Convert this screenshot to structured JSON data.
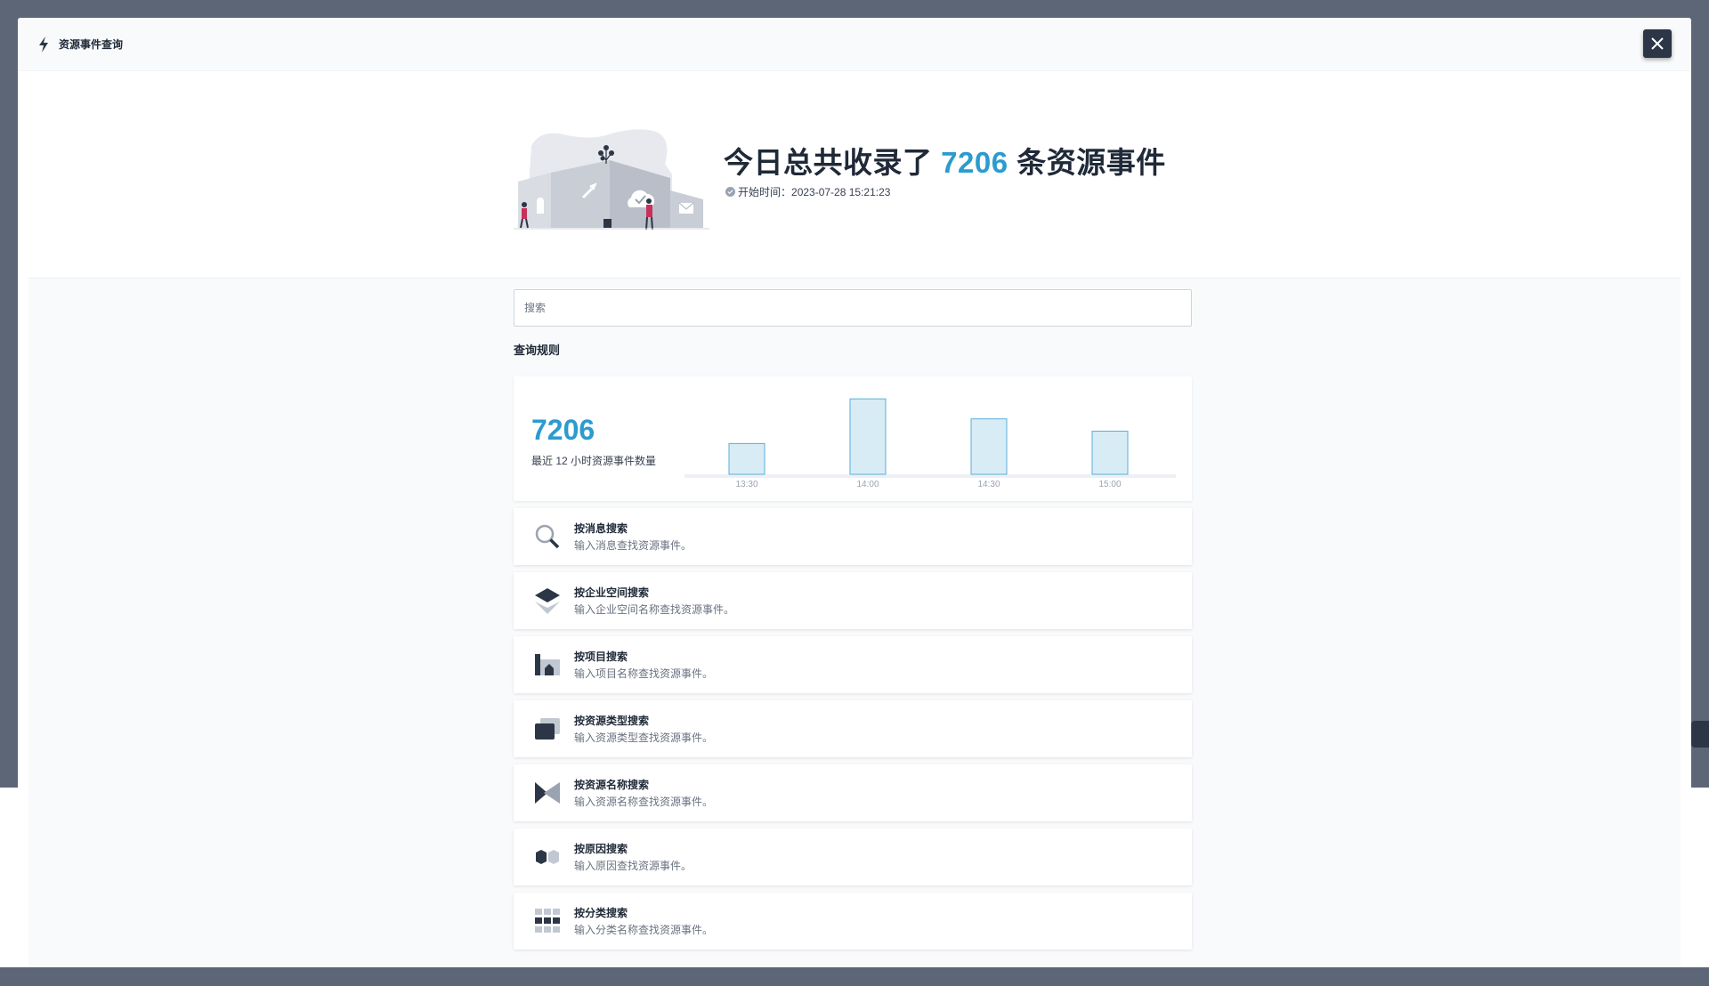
{
  "modal": {
    "title": "资源事件查询",
    "close_icon": "close-icon",
    "header_icon": "bolt-icon"
  },
  "hero": {
    "title_prefix": "今日总共收录了",
    "total": "7206",
    "title_suffix": "条资源事件",
    "start_label": "开始时间：",
    "start_time": "2023-07-28 15:21:23"
  },
  "search": {
    "placeholder": "搜索",
    "value": ""
  },
  "rules": {
    "section_title": "查询规则",
    "items": [
      {
        "title": "按消息搜索",
        "desc": "输入消息查找资源事件。",
        "icon": "magnifier-icon"
      },
      {
        "title": "按企业空间搜索",
        "desc": "输入企业空间名称查找资源事件。",
        "icon": "layers-icon"
      },
      {
        "title": "按项目搜索",
        "desc": "输入项目名称查找资源事件。",
        "icon": "project-icon"
      },
      {
        "title": "按资源类型搜索",
        "desc": "输入资源类型查找资源事件。",
        "icon": "cards-icon"
      },
      {
        "title": "按资源名称搜索",
        "desc": "输入资源名称查找资源事件。",
        "icon": "resource-name-icon"
      },
      {
        "title": "按原因搜索",
        "desc": "输入原因查找资源事件。",
        "icon": "hexagons-icon"
      },
      {
        "title": "按分类搜索",
        "desc": "输入分类名称查找资源事件。",
        "icon": "grid-icon"
      }
    ]
  },
  "stats": {
    "count": "7206",
    "label": "最近 12 小时资源事件数量"
  },
  "chart_data": {
    "type": "bar",
    "categories": [
      "13:30",
      "14:00",
      "14:30",
      "15:00"
    ],
    "values": [
      1000,
      2450,
      1800,
      1400
    ],
    "ylim": [
      0,
      2600
    ],
    "colors": {
      "fill": "#d8ecf6",
      "stroke": "#5aaed6",
      "axis": "#eef1f4",
      "tick": "#9aa3b1"
    }
  },
  "colors": {
    "accent": "#2b9bd0",
    "dark": "#2c3646",
    "backdrop": "#5d6677"
  }
}
